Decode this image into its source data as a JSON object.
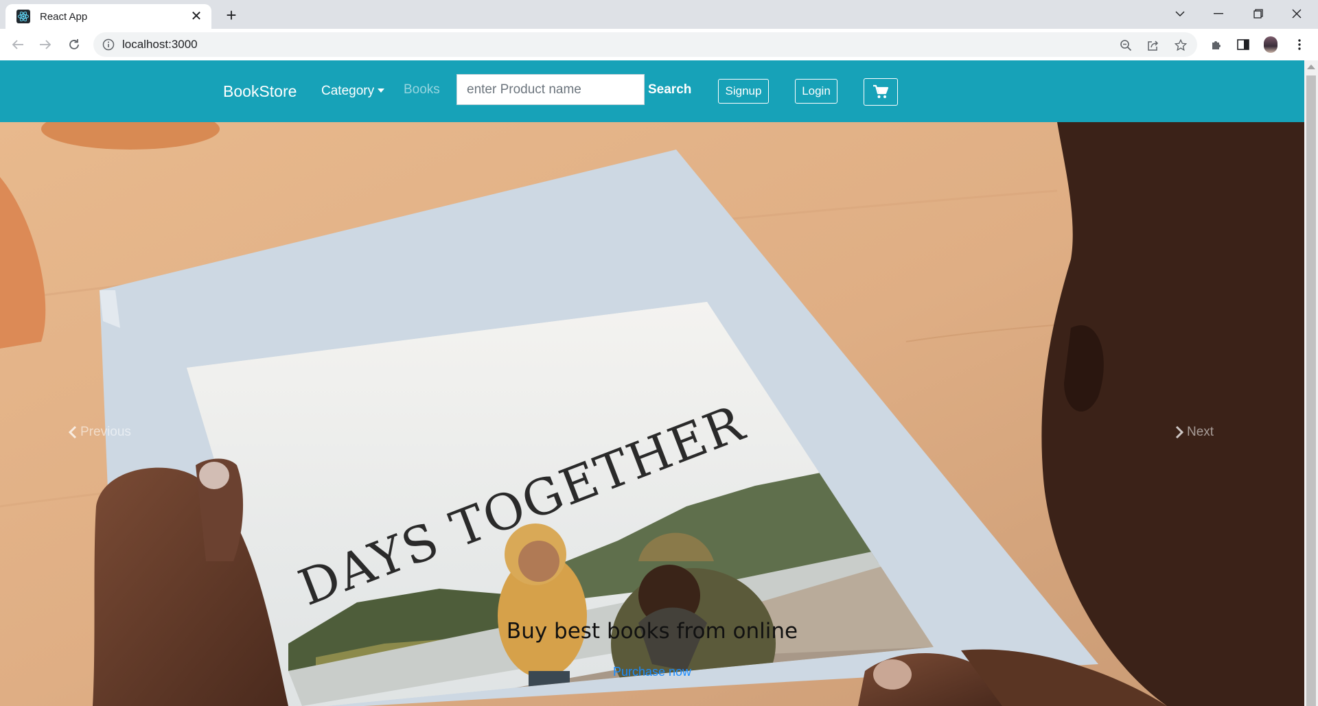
{
  "browser": {
    "tab_title": "React App",
    "url": "localhost:3000"
  },
  "navbar": {
    "brand": "BookStore",
    "category_label": "Category",
    "books_label": "Books",
    "search_placeholder": "enter Product name",
    "search_button": "Search",
    "signup_button": "Signup",
    "login_button": "Login",
    "background_color": "#17a2b8"
  },
  "carousel": {
    "slide_image_title": "DAYS TOGETHER",
    "previous_label": "Previous",
    "next_label": "Next",
    "caption_heading": "Buy best books from online",
    "caption_link": "Purchase now"
  }
}
